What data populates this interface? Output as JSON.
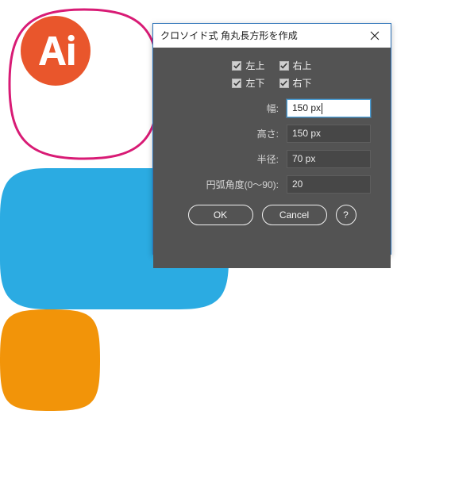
{
  "app": {
    "logo_label": "Ai",
    "logo_color": "#E9562C",
    "background_color": "#FFFFFF"
  },
  "dialog": {
    "title": "クロソイド式 角丸長方形を作成",
    "close_icon": "close-icon",
    "titlebar_color": "#FFFFFF",
    "body_color": "#535353",
    "border_color": "#2C72B8",
    "corner_checkboxes": [
      {
        "label": "左上",
        "checked": true
      },
      {
        "label": "右上",
        "checked": true
      },
      {
        "label": "左下",
        "checked": true
      },
      {
        "label": "右下",
        "checked": true
      }
    ],
    "fields": [
      {
        "label": "幅:",
        "value": "150 px",
        "focused": true
      },
      {
        "label": "高さ:",
        "value": "150 px",
        "focused": false
      },
      {
        "label": "半径:",
        "value": "70 px",
        "focused": false
      },
      {
        "label": "円弧角度(0〜90):",
        "value": "20",
        "focused": false
      }
    ],
    "buttons": {
      "ok_label": "OK",
      "cancel_label": "Cancel",
      "help_label": "?"
    }
  },
  "artwork": {
    "shapes": [
      {
        "name": "pink-squircle-outline",
        "fill": "none",
        "stroke": "#D81B75",
        "stroke_width": 3
      },
      {
        "name": "blue-rounded-rectangle",
        "fill": "#2BABE2",
        "stroke": "none"
      },
      {
        "name": "orange-squircle",
        "fill": "#F29409",
        "stroke": "none"
      }
    ]
  }
}
